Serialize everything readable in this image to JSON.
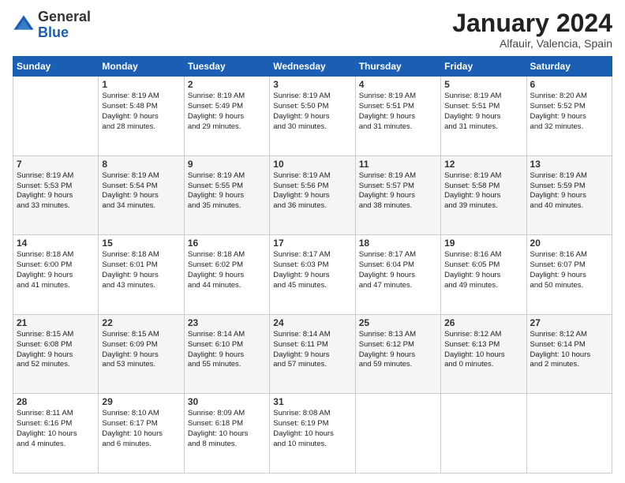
{
  "header": {
    "logo": {
      "general": "General",
      "blue": "Blue"
    },
    "title": "January 2024",
    "subtitle": "Alfauir, Valencia, Spain"
  },
  "calendar": {
    "weekdays": [
      "Sunday",
      "Monday",
      "Tuesday",
      "Wednesday",
      "Thursday",
      "Friday",
      "Saturday"
    ],
    "weeks": [
      [
        {
          "day": "",
          "info": ""
        },
        {
          "day": "1",
          "info": "Sunrise: 8:19 AM\nSunset: 5:48 PM\nDaylight: 9 hours\nand 28 minutes."
        },
        {
          "day": "2",
          "info": "Sunrise: 8:19 AM\nSunset: 5:49 PM\nDaylight: 9 hours\nand 29 minutes."
        },
        {
          "day": "3",
          "info": "Sunrise: 8:19 AM\nSunset: 5:50 PM\nDaylight: 9 hours\nand 30 minutes."
        },
        {
          "day": "4",
          "info": "Sunrise: 8:19 AM\nSunset: 5:51 PM\nDaylight: 9 hours\nand 31 minutes."
        },
        {
          "day": "5",
          "info": "Sunrise: 8:19 AM\nSunset: 5:51 PM\nDaylight: 9 hours\nand 31 minutes."
        },
        {
          "day": "6",
          "info": "Sunrise: 8:20 AM\nSunset: 5:52 PM\nDaylight: 9 hours\nand 32 minutes."
        }
      ],
      [
        {
          "day": "7",
          "info": "Sunrise: 8:19 AM\nSunset: 5:53 PM\nDaylight: 9 hours\nand 33 minutes."
        },
        {
          "day": "8",
          "info": "Sunrise: 8:19 AM\nSunset: 5:54 PM\nDaylight: 9 hours\nand 34 minutes."
        },
        {
          "day": "9",
          "info": "Sunrise: 8:19 AM\nSunset: 5:55 PM\nDaylight: 9 hours\nand 35 minutes."
        },
        {
          "day": "10",
          "info": "Sunrise: 8:19 AM\nSunset: 5:56 PM\nDaylight: 9 hours\nand 36 minutes."
        },
        {
          "day": "11",
          "info": "Sunrise: 8:19 AM\nSunset: 5:57 PM\nDaylight: 9 hours\nand 38 minutes."
        },
        {
          "day": "12",
          "info": "Sunrise: 8:19 AM\nSunset: 5:58 PM\nDaylight: 9 hours\nand 39 minutes."
        },
        {
          "day": "13",
          "info": "Sunrise: 8:19 AM\nSunset: 5:59 PM\nDaylight: 9 hours\nand 40 minutes."
        }
      ],
      [
        {
          "day": "14",
          "info": "Sunrise: 8:18 AM\nSunset: 6:00 PM\nDaylight: 9 hours\nand 41 minutes."
        },
        {
          "day": "15",
          "info": "Sunrise: 8:18 AM\nSunset: 6:01 PM\nDaylight: 9 hours\nand 43 minutes."
        },
        {
          "day": "16",
          "info": "Sunrise: 8:18 AM\nSunset: 6:02 PM\nDaylight: 9 hours\nand 44 minutes."
        },
        {
          "day": "17",
          "info": "Sunrise: 8:17 AM\nSunset: 6:03 PM\nDaylight: 9 hours\nand 45 minutes."
        },
        {
          "day": "18",
          "info": "Sunrise: 8:17 AM\nSunset: 6:04 PM\nDaylight: 9 hours\nand 47 minutes."
        },
        {
          "day": "19",
          "info": "Sunrise: 8:16 AM\nSunset: 6:05 PM\nDaylight: 9 hours\nand 49 minutes."
        },
        {
          "day": "20",
          "info": "Sunrise: 8:16 AM\nSunset: 6:07 PM\nDaylight: 9 hours\nand 50 minutes."
        }
      ],
      [
        {
          "day": "21",
          "info": "Sunrise: 8:15 AM\nSunset: 6:08 PM\nDaylight: 9 hours\nand 52 minutes."
        },
        {
          "day": "22",
          "info": "Sunrise: 8:15 AM\nSunset: 6:09 PM\nDaylight: 9 hours\nand 53 minutes."
        },
        {
          "day": "23",
          "info": "Sunrise: 8:14 AM\nSunset: 6:10 PM\nDaylight: 9 hours\nand 55 minutes."
        },
        {
          "day": "24",
          "info": "Sunrise: 8:14 AM\nSunset: 6:11 PM\nDaylight: 9 hours\nand 57 minutes."
        },
        {
          "day": "25",
          "info": "Sunrise: 8:13 AM\nSunset: 6:12 PM\nDaylight: 9 hours\nand 59 minutes."
        },
        {
          "day": "26",
          "info": "Sunrise: 8:12 AM\nSunset: 6:13 PM\nDaylight: 10 hours\nand 0 minutes."
        },
        {
          "day": "27",
          "info": "Sunrise: 8:12 AM\nSunset: 6:14 PM\nDaylight: 10 hours\nand 2 minutes."
        }
      ],
      [
        {
          "day": "28",
          "info": "Sunrise: 8:11 AM\nSunset: 6:16 PM\nDaylight: 10 hours\nand 4 minutes."
        },
        {
          "day": "29",
          "info": "Sunrise: 8:10 AM\nSunset: 6:17 PM\nDaylight: 10 hours\nand 6 minutes."
        },
        {
          "day": "30",
          "info": "Sunrise: 8:09 AM\nSunset: 6:18 PM\nDaylight: 10 hours\nand 8 minutes."
        },
        {
          "day": "31",
          "info": "Sunrise: 8:08 AM\nSunset: 6:19 PM\nDaylight: 10 hours\nand 10 minutes."
        },
        {
          "day": "",
          "info": ""
        },
        {
          "day": "",
          "info": ""
        },
        {
          "day": "",
          "info": ""
        }
      ]
    ]
  }
}
